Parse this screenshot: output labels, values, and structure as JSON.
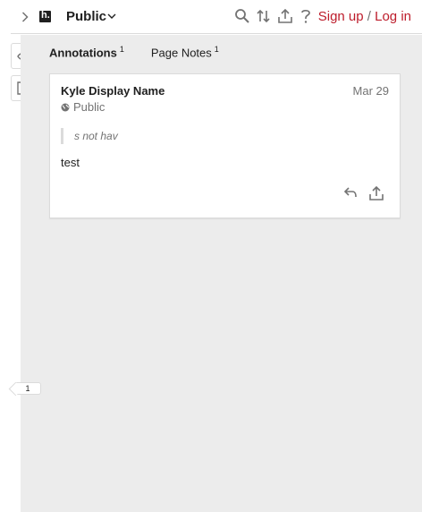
{
  "header": {
    "group_name": "Public",
    "sign_up": "Sign up",
    "separator": "/",
    "log_in": "Log in"
  },
  "tabs": [
    {
      "label": "Annotations",
      "count": "1",
      "active": true
    },
    {
      "label": "Page Notes",
      "count": "1",
      "active": false
    }
  ],
  "annotation": {
    "author": "Kyle Display Name",
    "date": "Mar 29",
    "visibility": "Public",
    "quote": "s not hav",
    "text": "test"
  },
  "bucket": {
    "count": "1"
  },
  "icons": {
    "sidebar_toggle": "chevron-right-icon",
    "logo": "hypothesis-logo",
    "group_dropdown": "chevron-down-icon",
    "search": "search-icon",
    "sort": "sort-icon",
    "share": "share-icon",
    "help": "help-icon",
    "show_highlights": "eye-icon",
    "new_page_note": "note-icon",
    "reply": "reply-icon",
    "annotation_share": "share-icon",
    "globe": "globe-icon"
  },
  "colors": {
    "brand_red": "#bd1c2b",
    "panel_bg": "#ececec",
    "muted_text": "#737373"
  }
}
